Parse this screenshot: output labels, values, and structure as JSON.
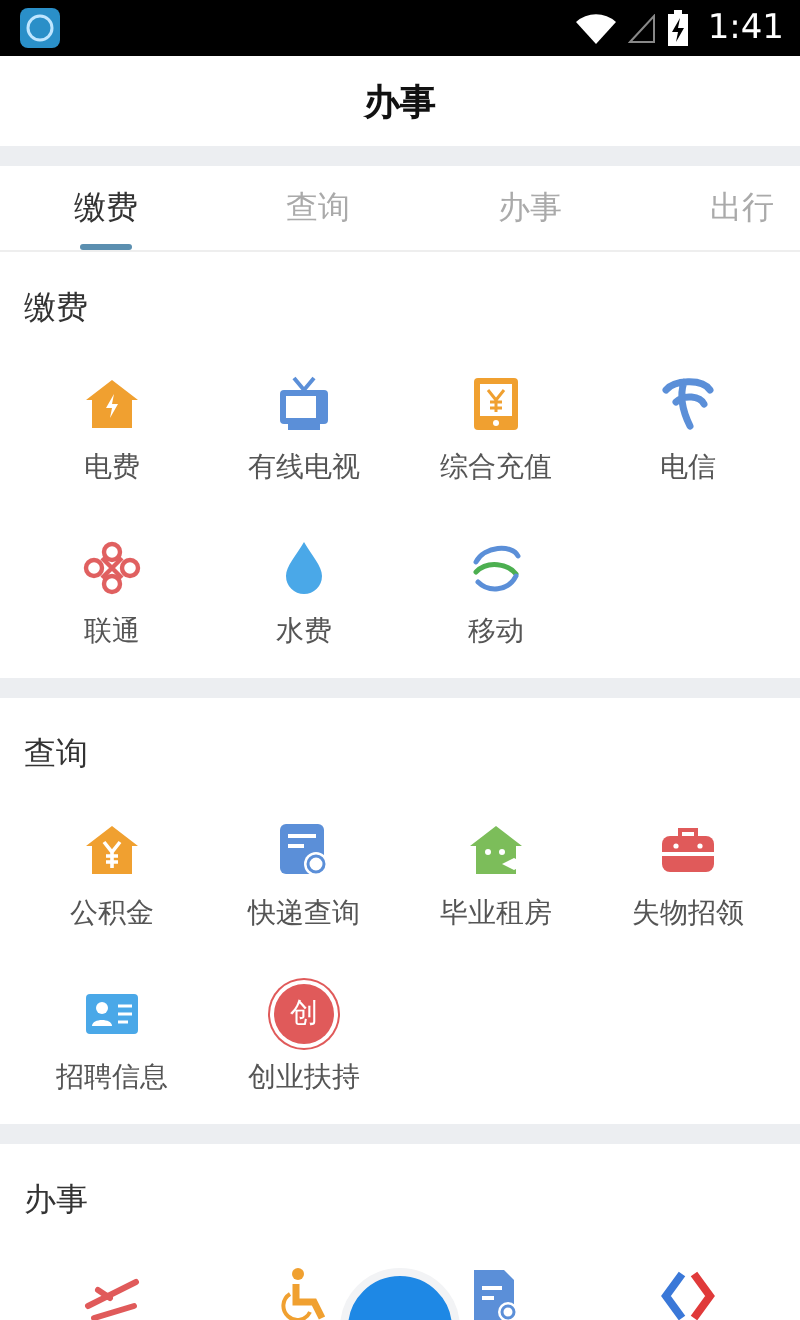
{
  "status_bar": {
    "time": "1:41"
  },
  "header": {
    "title": "办事"
  },
  "tabs": [
    {
      "label": "缴费",
      "selected": true
    },
    {
      "label": "查询",
      "selected": false
    },
    {
      "label": "办事",
      "selected": false
    },
    {
      "label": "出行",
      "selected": false
    }
  ],
  "sections": [
    {
      "title": "缴费",
      "items": [
        {
          "kind": "icon",
          "label": "电费"
        },
        {
          "kind": "icon",
          "label": "有线电视"
        },
        {
          "kind": "icon",
          "label": "综合充值"
        },
        {
          "kind": "icon",
          "label": "电信"
        },
        {
          "kind": "icon",
          "label": "联通"
        },
        {
          "kind": "icon",
          "label": "水费"
        },
        {
          "kind": "icon",
          "label": "移动"
        }
      ]
    },
    {
      "title": "查询",
      "items": [
        {
          "kind": "icon",
          "label": "公积金"
        },
        {
          "kind": "icon",
          "label": "快递查询"
        },
        {
          "kind": "icon",
          "label": "毕业租房"
        },
        {
          "kind": "icon",
          "label": "失物招领"
        },
        {
          "kind": "icon",
          "label": "招聘信息"
        },
        {
          "kind": "badge",
          "label": "创业扶持",
          "icon_text": "创"
        }
      ]
    },
    {
      "title": "办事",
      "items": [
        {
          "kind": "icon"
        },
        {
          "kind": "icon"
        },
        {
          "kind": "icon"
        },
        {
          "kind": "icon"
        }
      ]
    }
  ]
}
